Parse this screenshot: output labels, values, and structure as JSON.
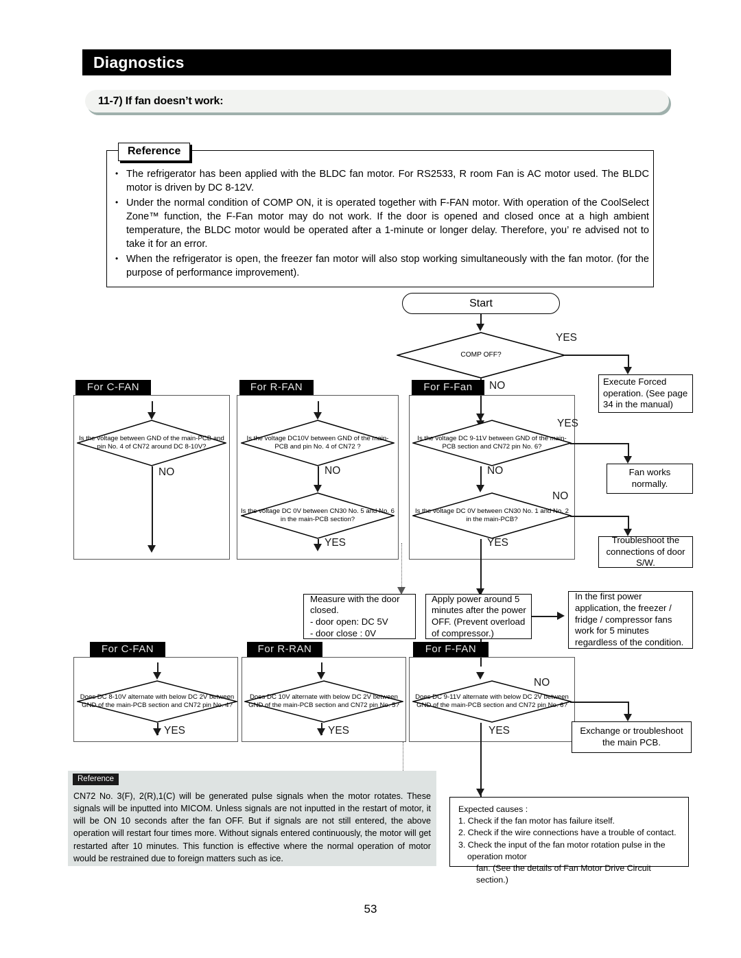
{
  "header": {
    "title": "Diagnostics"
  },
  "section": {
    "title": "11-7) If fan doesn’t work:"
  },
  "reference": {
    "tab_label": "Reference",
    "items": [
      "The refrigerator has been applied with the BLDC fan motor. For RS2533, R room Fan is AC motor used. The BLDC motor is driven by DC 8-12V.",
      "Under the normal condition of COMP ON, it is operated together with F-FAN motor. With operation of the CoolSelect Zone™ function, the F-Fan motor may do not work. If the door is opened and closed once at a high ambient temperature, the BLDC motor would be operated after a 1-minute or longer delay. Therefore, you’ re advised not to take it for an error.",
      "When the refrigerator is open, the freezer fan motor will also stop working simultaneously with the fan motor. (for the purpose of performance improvement)."
    ],
    "bullet": "•"
  },
  "flow": {
    "start": "Start",
    "comp_off": "COMP OFF?",
    "yes": "YES",
    "no": "NO",
    "group_labels": {
      "c_fan_top": "For C-FAN",
      "r_fan_top": "For R-FAN",
      "f_fan_top": "For F-Fan",
      "c_fan_bottom": "For C-FAN",
      "r_ran_bottom": "For R-RAN",
      "f_fan_bottom": "For F-FAN"
    },
    "diamonds": {
      "c_fan_top": "Is the voltage between GND of the main-PCB  and pin No. 4 of CN72 around DC 8-10V?",
      "r_fan_top": "Is the voltage DC10V between GND of the main-PCB and pin No. 4 of CN72 ?",
      "r_fan_second": "Is the voltage DC 0V between CN30 No. 5 and No. 6 in the main-PCB section?",
      "f_fan_top": "Is the voltage DC 9-11V between GND of the main-PCB section and CN72 pin No. 6?",
      "f_fan_second": "Is the voltage DC 0V between CN30 No. 1 and No. 2 in the main-PCB?",
      "c_fan_bottom": "Does DC 8-10V alternate with below DC 2V between GND of the main-PCB section and CN72 pin No. 4?",
      "r_ran_bottom": "Does DC 10V alternate with below DC 2V between GND of the main-PCB section and CN72 pin No. 5?",
      "f_fan_bottom": "Does DC 9-11V alternate with below DC 2V between GND of the main-PCB section and CN72 pin No. 6?"
    },
    "boxes": {
      "execute_forced": "Execute Forced operation. (See page 34 in the manual)",
      "fan_works": "Fan works normally.",
      "troubleshoot_door": "Troubleshoot the connections of door S/W.",
      "measure_door_l1": "Measure with the door closed.",
      "measure_door_l2": "- door open: DC 5V",
      "measure_door_l3": "- door close : 0V",
      "apply_power": "Apply power around 5 minutes after the power OFF. (Prevent overload of compressor.)",
      "first_power": "In the first power application, the freezer / fridge / compressor fans work for 5 minutes regardless of the condition.",
      "exchange_pcb": "Exchange or troubleshoot the main PCB."
    }
  },
  "note": {
    "tab_label": "Reference",
    "text": "CN72 No. 3(F), 2(R),1(C) will be generated pulse signals when the motor rotates. These signals will be inputted into MICOM. Unless signals are not inputted in the restart of motor, it will be ON 10 seconds after the fan OFF. But if signals are not still entered, the  above operation will restart four times more. Without signals entered continuously, the motor will get restarted after 10 minutes. This function is effective where the normal operation of motor would be restrained due to foreign matters such as ice."
  },
  "causes": {
    "heading": "Expected causes :",
    "items": [
      "1. Check if the fan motor has failure itself.",
      "2. Check if the wire connections have a trouble of contact.",
      "3. Check the input of the fan motor rotation pulse in the operation motor",
      "fan. (See the details of Fan Motor Drive Circuit section.)"
    ]
  },
  "footer": {
    "page_number": "53"
  }
}
